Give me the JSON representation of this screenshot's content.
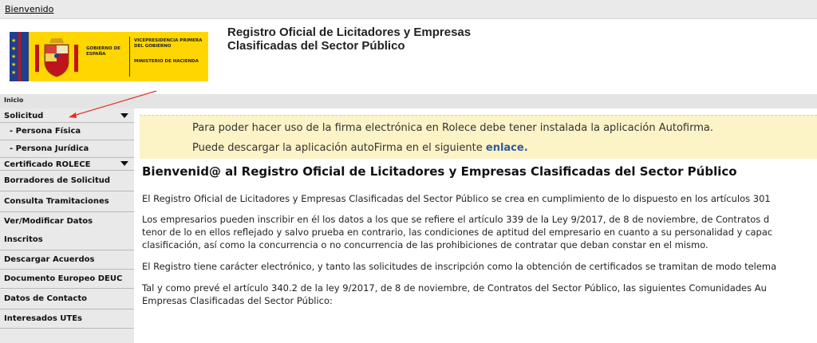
{
  "topbar": {
    "welcome_link": "Bienvenido"
  },
  "logo": {
    "gobierno": "GOBIERNO DE ESPAÑA",
    "vicepresidencia": "VICEPRESIDENCIA PRIMERA DEL GOBIERNO",
    "ministerio": "MINISTERIO DE HACIENDA"
  },
  "header": {
    "title_line1": "Registro Oficial de Licitadores y Empresas",
    "title_line2": "Clasificadas del Sector Público"
  },
  "breadcrumb": {
    "home": "Inicio"
  },
  "sidebar": {
    "items": [
      {
        "label": "Solicitud"
      },
      {
        "label": "- Persona Física"
      },
      {
        "label": "- Persona Jurídica"
      },
      {
        "label": "Certificado ROLECE"
      },
      {
        "label": "Borradores de Solicitud"
      },
      {
        "label": "Consulta Tramitaciones"
      },
      {
        "label": "Ver/Modificar Datos"
      },
      {
        "label": "Inscritos"
      },
      {
        "label": "Descargar Acuerdos"
      },
      {
        "label": "Documento Europeo DEUC"
      },
      {
        "label": "Datos de Contacto"
      },
      {
        "label": "Interesados UTEs"
      }
    ]
  },
  "notice": {
    "line1": "Para poder hacer uso de la firma electrónica en Rolece debe tener instalada la aplicación Autofirma.",
    "line2_prefix": "Puede descargar la aplicación autoFirma en el siguiente ",
    "line2_link": "enlace."
  },
  "content": {
    "heading": "Bienvenid@ al Registro Oficial de Licitadores y Empresas Clasificadas del Sector Público",
    "p1": "El Registro Oficial de Licitadores y Empresas Clasificadas del Sector Público se crea en cumplimiento de lo dispuesto en los artículos 301",
    "p2_l1": "Los empresarios pueden inscribir en él los datos a los que se refiere el artículo 339 de la Ley 9/2017, de 8 de noviembre, de Contratos d",
    "p2_l2": "tenor de lo en ellos reflejado y salvo prueba en contrario, las condiciones de aptitud del empresario en cuanto a su personalidad y capac",
    "p2_l3": "clasificación, así como la concurrencia o no concurrencia de las prohibiciones de contratar que deban constar en el mismo.",
    "p3": "El Registro tiene carácter electrónico, y tanto las solicitudes de inscripción como la obtención de certificados se tramitan de modo telema",
    "p4_l1": "Tal y como prevé el artículo 340.2 de la ley 9/2017, de 8 de noviembre, de Contratos del Sector Público, las siguientes Comunidades Au",
    "p4_l2": "Empresas Clasificadas del Sector Público:"
  },
  "colors": {
    "notice_bg": "#fcf3c7",
    "link": "#2f5a9c",
    "logo_yellow": "#ffd600",
    "annotation_arrow": "#e0322a"
  }
}
